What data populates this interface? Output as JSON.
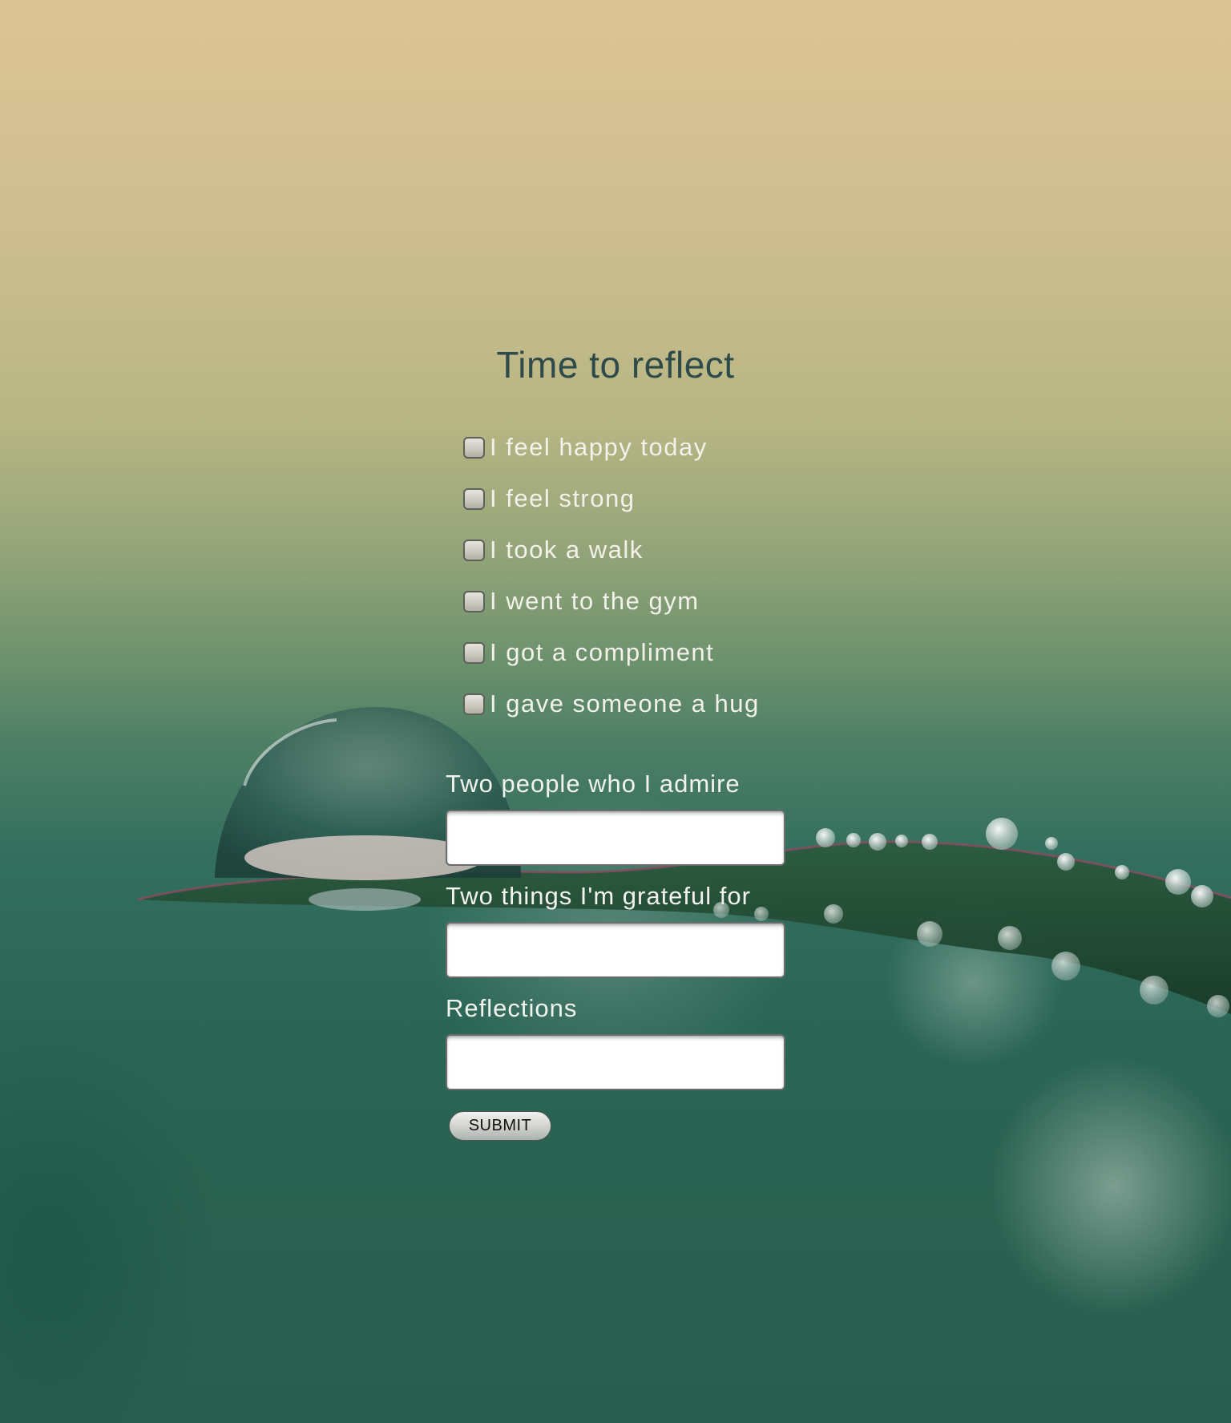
{
  "page": {
    "title": "Time to reflect"
  },
  "checklist": [
    {
      "label": "I feel happy today",
      "checked": false
    },
    {
      "label": "I feel strong",
      "checked": false
    },
    {
      "label": "I took a walk",
      "checked": false
    },
    {
      "label": "I went to the gym",
      "checked": false
    },
    {
      "label": "I got a compliment",
      "checked": false
    },
    {
      "label": "I gave someone a hug",
      "checked": false
    }
  ],
  "fields": {
    "admire": {
      "label": "Two people who I admire",
      "value": ""
    },
    "grateful": {
      "label": "Two things I'm grateful for",
      "value": ""
    },
    "reflections": {
      "label": "Reflections",
      "value": ""
    }
  },
  "submit": {
    "label": "SUBMIT"
  },
  "background": {
    "top_color": "#dcc495",
    "bottom_color": "#285e4e",
    "leaf_color": "#1f4a33",
    "title_color": "#2f4a4a"
  }
}
